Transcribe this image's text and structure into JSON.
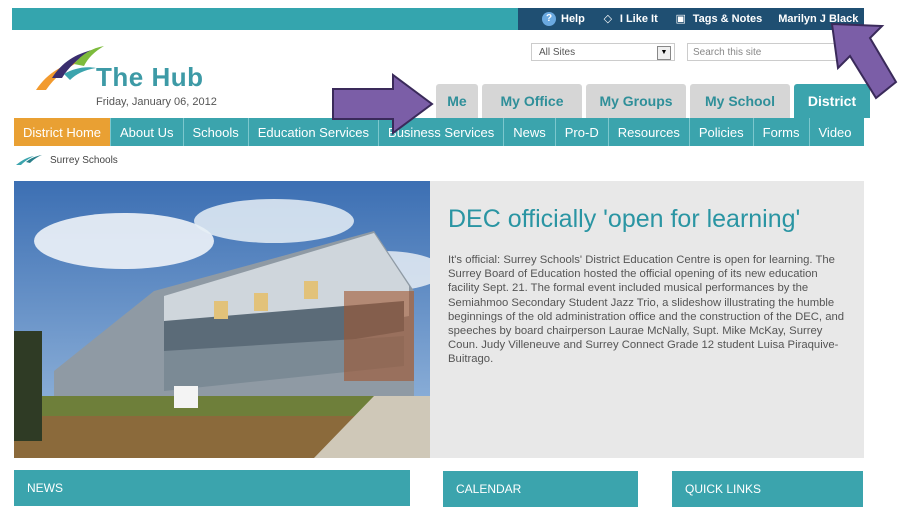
{
  "topbar": {
    "help_label": "Help",
    "like_label": "I Like It",
    "tags_label": "Tags & Notes",
    "user_label": "Marilyn J Black"
  },
  "header": {
    "site_title": "The Hub",
    "date": "Friday, January 06, 2012",
    "site_select_value": "All Sites",
    "search_placeholder": "Search this site"
  },
  "tabs": [
    {
      "label": "Me",
      "active": false
    },
    {
      "label": "My Office",
      "active": false
    },
    {
      "label": "My Groups",
      "active": false
    },
    {
      "label": "My School",
      "active": false
    },
    {
      "label": "District",
      "active": true
    }
  ],
  "nav": [
    {
      "label": "District Home",
      "active": true
    },
    {
      "label": "About Us"
    },
    {
      "label": "Schools"
    },
    {
      "label": "Education Services"
    },
    {
      "label": "Business Services"
    },
    {
      "label": "News"
    },
    {
      "label": "Pro-D"
    },
    {
      "label": "Resources"
    },
    {
      "label": "Policies"
    },
    {
      "label": "Forms"
    },
    {
      "label": "Video"
    }
  ],
  "breadcrumb": {
    "label": "Surrey Schools"
  },
  "feature": {
    "title": "DEC officially 'open for learning'",
    "body": "It's official: Surrey Schools' District Education Centre is open for learning. The Surrey Board of Education hosted the official opening of its new education facility Sept. 21. The formal event included musical performances by the Semiahmoo Secondary Student Jazz Trio, a slideshow illustrating the humble beginnings of the old administration office and the construction of the DEC, and speeches by board chairperson Laurae McNally, Supt. Mike McKay, Surrey Coun. Judy Villeneuve and Surrey Connect Grade 12 student Luisa Piraquive-Buitrago."
  },
  "panels": {
    "news": "NEWS",
    "calendar": "CALENDAR",
    "quick_links": "QUICK LINKS"
  },
  "colors": {
    "teal": "#3ba4ad",
    "navy": "#1f4f72",
    "orange": "#e9a033",
    "arrow_purple": "#7b5ea7"
  }
}
